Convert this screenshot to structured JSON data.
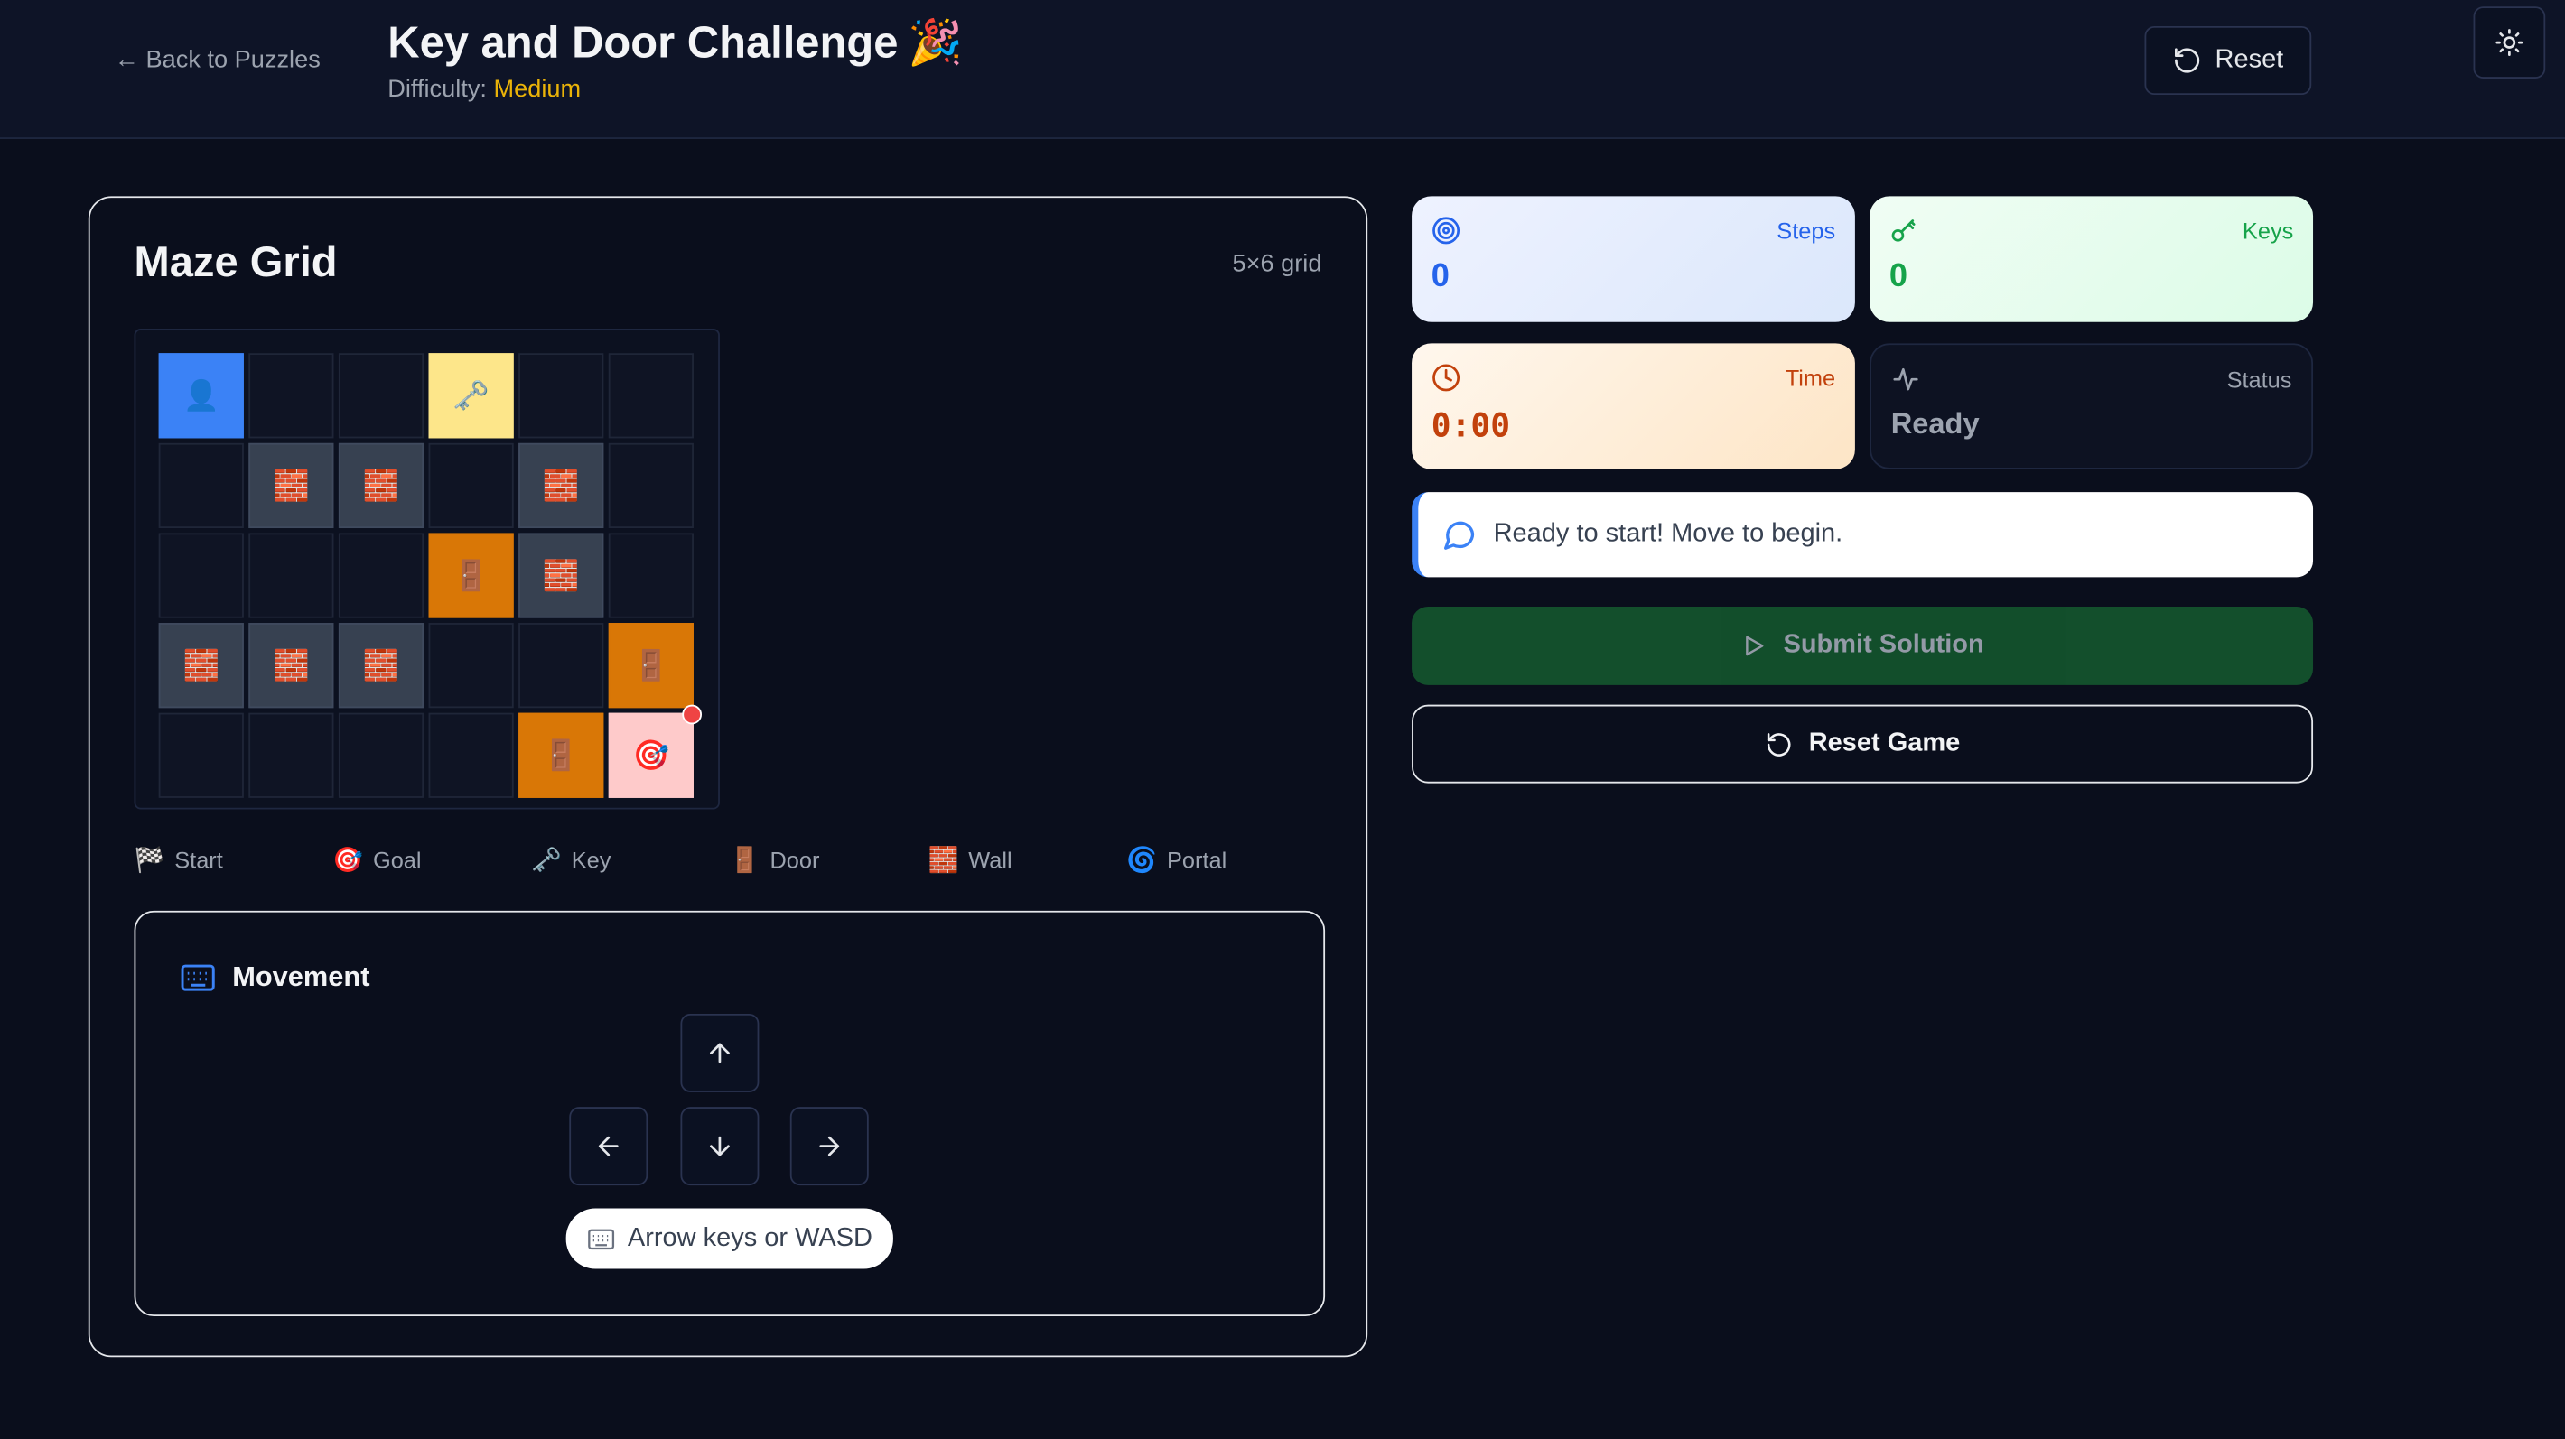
{
  "header": {
    "back_label": "← Back to Puzzles",
    "title": "Key and Door Challenge",
    "title_emoji": "🎉",
    "difficulty_label": "Difficulty:",
    "difficulty_value": "Medium",
    "reset_label": "Reset"
  },
  "maze": {
    "title": "Maze Grid",
    "size_label": "5×6 grid",
    "rows": [
      [
        "start",
        "empty",
        "empty",
        "key",
        "empty",
        "empty"
      ],
      [
        "empty",
        "wall",
        "wall",
        "empty",
        "wall",
        "empty"
      ],
      [
        "empty",
        "empty",
        "empty",
        "door",
        "wall",
        "empty"
      ],
      [
        "wall",
        "wall",
        "wall",
        "empty",
        "empty",
        "door"
      ],
      [
        "empty",
        "empty",
        "empty",
        "empty",
        "door",
        "goal"
      ]
    ],
    "cell_icons": {
      "start": "👤",
      "key": "🗝️",
      "door": "🚪",
      "wall": "🧱",
      "goal": "🎯",
      "empty": ""
    }
  },
  "legend": [
    {
      "icon": "🏁",
      "label": "Start"
    },
    {
      "icon": "🎯",
      "label": "Goal"
    },
    {
      "icon": "🗝️",
      "label": "Key"
    },
    {
      "icon": "🚪",
      "label": "Door"
    },
    {
      "icon": "🧱",
      "label": "Wall"
    },
    {
      "icon": "🌀",
      "label": "Portal"
    }
  ],
  "movement": {
    "title": "Movement",
    "hint": "Arrow keys or WASD"
  },
  "stats": {
    "steps": {
      "label": "Steps",
      "value": "0"
    },
    "keys": {
      "label": "Keys",
      "value": "0"
    },
    "time": {
      "label": "Time",
      "value": "0:00"
    },
    "status": {
      "label": "Status",
      "value": "Ready"
    }
  },
  "message": "Ready to start! Move to begin.",
  "submit_label": "Submit Solution",
  "reset_game_label": "Reset Game"
}
